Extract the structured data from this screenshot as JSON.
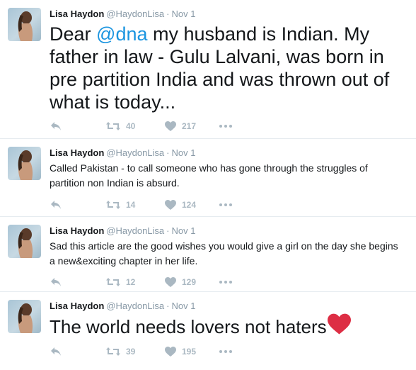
{
  "tweets": [
    {
      "name": "Lisa Haydon",
      "handle": "@HaydonLisa",
      "separator": "·",
      "time": "Nov 1",
      "text_before": "Dear ",
      "mention": "@dna",
      "text_after": " my husband is Indian. My father in law - Gulu Lalvani, was born in pre partition India and was thrown out of what is today...",
      "retweets": "40",
      "likes": "217"
    },
    {
      "name": "Lisa Haydon",
      "handle": "@HaydonLisa",
      "separator": "·",
      "time": "Nov 1",
      "text": "Called Pakistan - to call someone who has gone through the struggles of partition non Indian is absurd.",
      "retweets": "14",
      "likes": "124"
    },
    {
      "name": "Lisa Haydon",
      "handle": "@HaydonLisa",
      "separator": "·",
      "time": "Nov 1",
      "text": "Sad this article are the good wishes you would give a girl on the day she begins a new&exciting chapter in her life.",
      "retweets": "12",
      "likes": "129"
    },
    {
      "name": "Lisa Haydon",
      "handle": "@HaydonLisa",
      "separator": "·",
      "time": "Nov 1",
      "text": "The world needs lovers not haters",
      "emoji": "red-heart-emoji",
      "retweets": "39",
      "likes": "195"
    }
  ],
  "icons": {
    "reply": "reply-icon",
    "retweet": "retweet-icon",
    "like": "heart-icon",
    "more": "more-icon"
  },
  "colors": {
    "mention": "#1b95e0",
    "action_gray": "#aab8c2",
    "meta_gray": "#8899a6",
    "heart_emoji": "#dd2e44"
  }
}
